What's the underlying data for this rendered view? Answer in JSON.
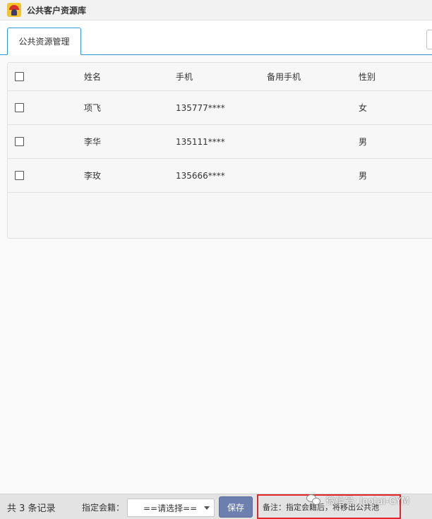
{
  "window": {
    "title": "公共客户资源库",
    "icon": "app-logo-icon"
  },
  "tabs": [
    {
      "label": "公共资源管理",
      "active": true
    }
  ],
  "table": {
    "columns": [
      "姓名",
      "手机",
      "备用手机",
      "性别"
    ],
    "rows": [
      {
        "name": "项飞",
        "phone": "135777****",
        "backup_phone": "",
        "gender": "女"
      },
      {
        "name": "李华",
        "phone": "135111****",
        "backup_phone": "",
        "gender": "男"
      },
      {
        "name": "李玫",
        "phone": "135666****",
        "backup_phone": "",
        "gender": "男"
      }
    ]
  },
  "footer": {
    "total_text": "共 3 条记录",
    "assign_label": "指定会籍：",
    "select_value": "==请选择==",
    "save_label": "保存",
    "remark": "备注：指定会籍后，将移出公共池"
  },
  "watermark": {
    "text": "微信号: Jootai-GYM",
    "icon": "wechat-icon"
  },
  "colors": {
    "tab_accent": "#2f97d8",
    "save_button": "#6c7fae",
    "remark_border": "#e0252b"
  }
}
